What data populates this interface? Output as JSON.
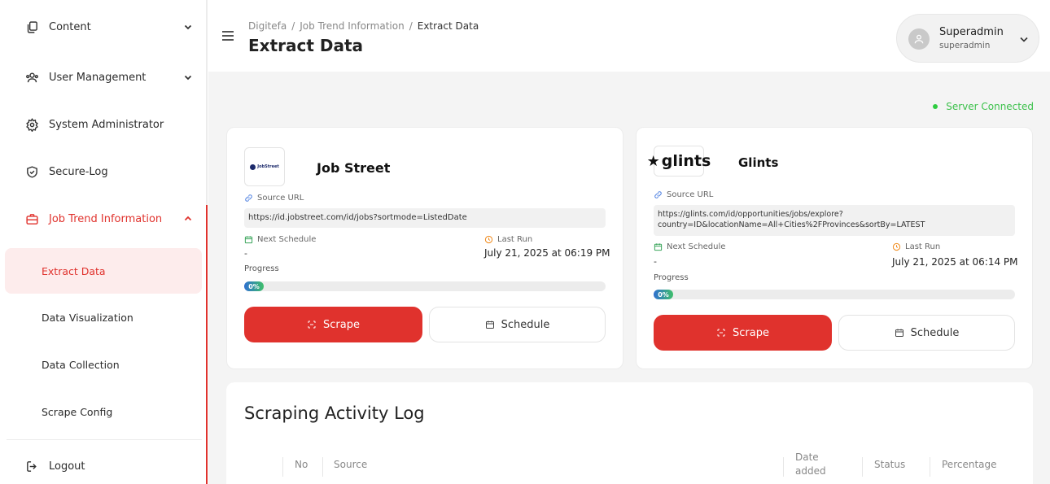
{
  "sidebar": {
    "items": [
      {
        "label": "Content",
        "icon": "copy-icon",
        "chevron": "down"
      },
      {
        "label": "User Management",
        "icon": "users-icon",
        "chevron": "down"
      },
      {
        "label": "System Administrator",
        "icon": "gear-icon"
      },
      {
        "label": "Secure-Log",
        "icon": "shield-check-icon"
      },
      {
        "label": "Job Trend Information",
        "icon": "briefcase-icon",
        "chevron": "up",
        "active": true
      }
    ],
    "subitems": [
      {
        "label": "Extract Data",
        "active": true
      },
      {
        "label": "Data Visualization"
      },
      {
        "label": "Data Collection"
      },
      {
        "label": "Scrape Config"
      }
    ],
    "logout": "Logout"
  },
  "header": {
    "breadcrumb": [
      "Digitefa",
      "Job Trend Information",
      "Extract Data"
    ],
    "title": "Extract Data",
    "user": {
      "name": "Superadmin",
      "role": "superadmin"
    }
  },
  "server_status": "Server Connected",
  "sources": [
    {
      "name": "Job Street",
      "logo_text": "JobStreet",
      "source_url_label": "Source URL",
      "url": "https://id.jobstreet.com/id/jobs?sortmode=ListedDate",
      "next_schedule_label": "Next Schedule",
      "next_schedule": "-",
      "last_run_label": "Last Run",
      "last_run": "July 21, 2025 at 06:19 PM",
      "progress_label": "Progress",
      "progress": "0%",
      "scrape_label": "Scrape",
      "schedule_label": "Schedule"
    },
    {
      "name": "Glints",
      "logo_text": "glints",
      "source_url_label": "Source URL",
      "url": "https://glints.com/id/opportunities/jobs/explore?country=ID&locationName=All+Cities%2FProvinces&sortBy=LATEST",
      "next_schedule_label": "Next Schedule",
      "next_schedule": "-",
      "last_run_label": "Last Run",
      "last_run": "July 21, 2025 at 06:14 PM",
      "progress_label": "Progress",
      "progress": "0%",
      "scrape_label": "Scrape",
      "schedule_label": "Schedule"
    }
  ],
  "activity_log": {
    "title": "Scraping Activity Log",
    "columns": [
      "No",
      "Source",
      "Date added",
      "Status",
      "Percentage"
    ]
  },
  "colors": {
    "accent": "#e0322d",
    "success": "#3cc14b"
  }
}
